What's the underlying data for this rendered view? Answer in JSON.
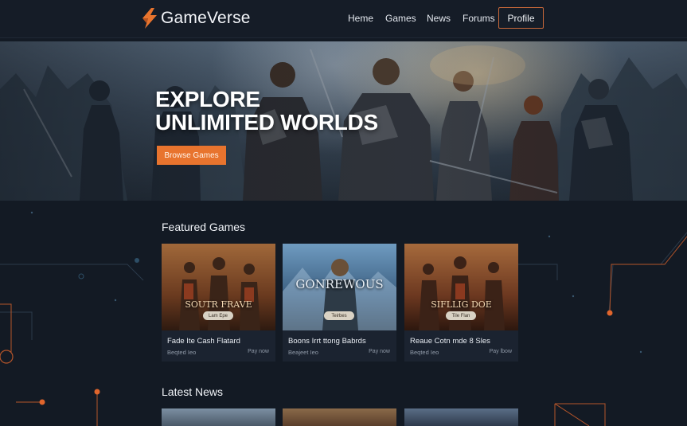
{
  "brand": {
    "name": "GameVerse",
    "accent": "#e8742e"
  },
  "nav": {
    "links": [
      "Heme",
      "Games",
      "News",
      "Forums"
    ],
    "profile": "Profile"
  },
  "hero": {
    "title_line1": "EXPLORE",
    "title_line2": "UNLIMITED WORLDS",
    "cta": "Browse Games"
  },
  "featured": {
    "heading": "Featured Games",
    "cards": [
      {
        "art_text": "SOUTR FRAVE",
        "pill": "Lam Epe",
        "title": "Fade Ite Cash Flatard",
        "subtitle": "Beqted Ieo",
        "link": "Pay now"
      },
      {
        "art_text": "GONREWOUS",
        "pill": "Teirbes",
        "title": "Boons Irrt ttong Babrds",
        "subtitle": "Beajeet Ieo",
        "link": "Pay now"
      },
      {
        "art_text": "SIFLLIG DOE",
        "pill": "Tile Flan",
        "title": "Reaue Cotn mde 8 Sles",
        "subtitle": "Beqted Ieo",
        "link": "Pay lbow"
      }
    ]
  },
  "news": {
    "heading": "Latest News"
  }
}
